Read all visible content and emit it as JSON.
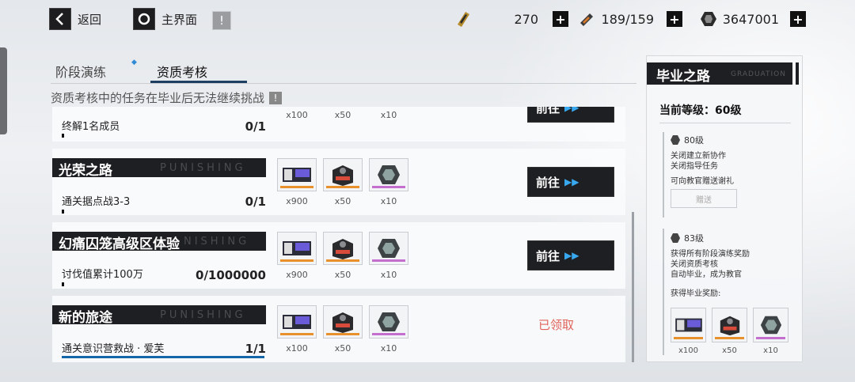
{
  "topbar": {
    "back_label": "返回",
    "home_label": "主界面",
    "back_icon": "chevron-left-icon",
    "home_icon": "circle-icon",
    "info_icon": "exclamation-icon"
  },
  "resources": [
    {
      "icon": "ticket-icon",
      "value": "270"
    },
    {
      "icon": "battery-icon",
      "value": "189/159"
    },
    {
      "icon": "coin-icon",
      "value": "3647001"
    }
  ],
  "tabs": [
    {
      "label": "阶段演练"
    },
    {
      "label": "资质考核"
    }
  ],
  "notice": "资质考核中的任务在毕业后无法继续挑战",
  "tasks": [
    {
      "title": "",
      "desc": "终解1名成员",
      "progress": "0/1",
      "progress_fraction": 0,
      "rewards": [
        {
          "qty": "x100",
          "color": "#e8912c"
        },
        {
          "qty": "x50",
          "color": "#e8912c"
        },
        {
          "qty": "x10",
          "color": "#c46fd0"
        }
      ],
      "action": "前往"
    },
    {
      "title": "光荣之路",
      "watermark": "PUNISHING",
      "desc": "通关据点战3-3",
      "progress": "0/1",
      "progress_fraction": 0,
      "rewards": [
        {
          "qty": "x900",
          "color": "#e8912c"
        },
        {
          "qty": "x50",
          "color": "#e8912c"
        },
        {
          "qty": "x10",
          "color": "#c46fd0"
        }
      ],
      "action": "前往"
    },
    {
      "title": "幻痛囚笼高级区体验",
      "watermark": "NISHING",
      "desc": "讨伐值累计100万",
      "progress": "0/1000000",
      "progress_fraction": 0,
      "rewards": [
        {
          "qty": "x900",
          "color": "#e8912c"
        },
        {
          "qty": "x50",
          "color": "#e8912c"
        },
        {
          "qty": "x10",
          "color": "#c46fd0"
        }
      ],
      "action": "前往"
    },
    {
      "title": "新的旅途",
      "watermark": "PUNISHING",
      "desc": "通关意识营救战 · 爱芙",
      "progress": "1/1",
      "progress_fraction": 1,
      "rewards": [
        {
          "qty": "x100",
          "color": "#e8912c"
        },
        {
          "qty": "x50",
          "color": "#e8912c"
        },
        {
          "qty": "x10",
          "color": "#c46fd0"
        }
      ],
      "status": "已领取"
    }
  ],
  "panel": {
    "title": "毕业之路",
    "title_en": "GRADUATION",
    "current_level": "当前等级：60级",
    "level80": {
      "label": "80级",
      "lines": [
        "关闭建立新协作",
        "关闭指导任务"
      ],
      "gift_desc": "可向教官赠送谢礼",
      "gift_button": "赠送"
    },
    "level83": {
      "label": "83级",
      "lines": [
        "获得所有阶段演练奖励",
        "关闭资质考核",
        "自动毕业，成为教官"
      ],
      "reward_title": "获得毕业奖励:",
      "rewards": [
        {
          "qty": "x100",
          "color": "#e8912c"
        },
        {
          "qty": "x50",
          "color": "#e8912c"
        },
        {
          "qty": "x10",
          "color": "#c46fd0"
        }
      ]
    }
  }
}
